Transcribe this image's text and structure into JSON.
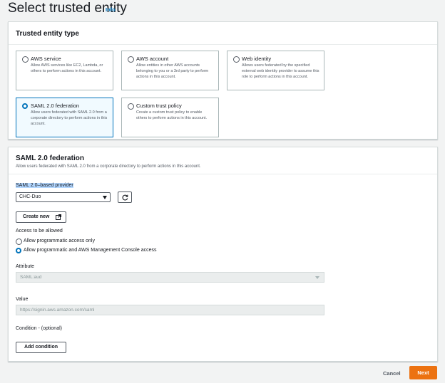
{
  "page": {
    "title": "Select trusted entity",
    "info_link": "Info"
  },
  "entity_type": {
    "title": "Trusted entity type",
    "options": [
      {
        "title": "AWS service",
        "desc": "Allow AWS services like EC2, Lambda, or others to perform actions in this account."
      },
      {
        "title": "AWS account",
        "desc": "Allow entities in other AWS accounts belonging to you or a 3rd party to perform actions in this account."
      },
      {
        "title": "Web identity",
        "desc": "Allows users federated by the specified external web identity provider to assume this role to perform actions in this account."
      },
      {
        "title": "SAML 2.0 federation",
        "desc": "Allow users federated with SAML 2.0 from a corporate directory to perform actions in this account."
      },
      {
        "title": "Custom trust policy",
        "desc": "Create a custom trust policy to enable others to perform actions in this account."
      }
    ],
    "selected": "SAML 2.0 federation"
  },
  "saml": {
    "title": "SAML 2.0 federation",
    "subtitle": "Allow users federated with SAML 2.0 from a corporate directory to perform actions in this account.",
    "provider_label": "SAML 2.0–based provider",
    "provider_value": "CHC-Duo",
    "create_new": "Create new",
    "access_label": "Access to be allowed",
    "access_options": [
      "Allow programmatic access only",
      "Allow programmatic and AWS Management Console access"
    ],
    "access_selected": "Allow programmatic and AWS Management Console access",
    "attribute_label": "Attribute",
    "attribute_value": "SAML:aud",
    "value_label": "Value",
    "value_value": "https://signin.aws.amazon.com/saml",
    "condition_label": "Condition - (optional)",
    "add_condition": "Add condition"
  },
  "footer": {
    "cancel": "Cancel",
    "next": "Next"
  },
  "colors": {
    "accent": "#0073bb",
    "primary_button": "#ec7211"
  }
}
